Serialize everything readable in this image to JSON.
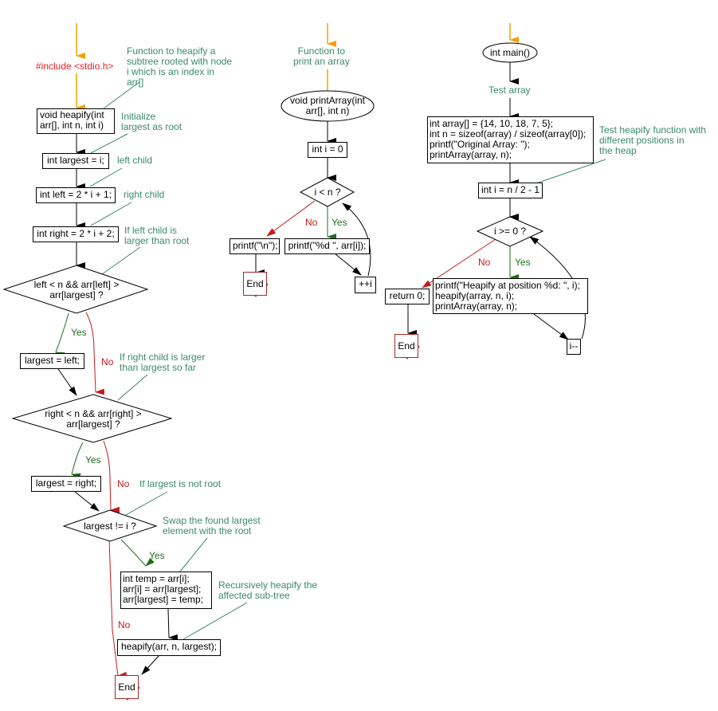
{
  "heapify_flow": {
    "include": "#include <stdio.h>",
    "comment_heapify": "Function to heapify a\nsubtree rooted with node\ni which is an index in\narr[]",
    "signature": "void heapify(int\narr[], int n, int i)",
    "comment_init": "Initialize\nlargest as root",
    "init_largest": "int largest = i;",
    "comment_left": "left child",
    "init_left": "int left = 2 * i + 1;",
    "comment_right": "right child",
    "init_right": "int right = 2 * i + 2;",
    "comment_left_larger": "If left child is\nlarger than root",
    "cond_left": "left < n && arr[left] >\narr[largest] ?",
    "yes1": "Yes",
    "no1": "No",
    "assign_left": "largest = left;",
    "comment_right_larger": "If right child is larger\nthan largest so far",
    "cond_right": "right < n && arr[right] >\narr[largest] ?",
    "yes2": "Yes",
    "no2": "No",
    "assign_right": "largest = right;",
    "comment_not_root": "If largest is not root",
    "cond_not_root": "largest != i ?",
    "comment_swap": "Swap the found largest\nelement with the root",
    "yes3": "Yes",
    "no3": "No",
    "swap": "int temp = arr[i];\narr[i] = arr[largest];\narr[largest] = temp;",
    "comment_recursive": "Recursively heapify the\naffected sub-tree",
    "recurse": "heapify(arr, n, largest);",
    "end": "End"
  },
  "print_flow": {
    "comment": "Function to\nprint an array",
    "signature": "void printArray(int\narr[], int n)",
    "init_i": "int i = 0",
    "cond": "i < n ?",
    "no": "No",
    "yes": "Yes",
    "newline": "printf(\"\\n\");",
    "print_elem": "printf(\"%d \", arr[i]);",
    "increment": "++i",
    "end": "End"
  },
  "main_flow": {
    "signature": "int main()",
    "comment_test_array": "Test array",
    "setup": "int array[] = {14, 10, 18, 7, 5};\nint n = sizeof(array) / sizeof(array[0]);\nprintf(\"Original Array: \");\nprintArray(array, n);",
    "comment_test_heapify": "Test heapify function with\ndifferent positions in\nthe heap",
    "init_i": "int i = n / 2 - 1",
    "cond": "i >= 0 ?",
    "no": "No",
    "yes": "Yes",
    "return": "return 0;",
    "body": "printf(\"Heapify at position %d: \", i);\nheapify(array, n, i);\nprintArray(array, n);",
    "decrement": "i--",
    "end": "End"
  },
  "colors": {
    "entry_arrow": "#f5a000",
    "include_text": "#e8201c",
    "comment_text": "#3a8a6a",
    "yes_branch": "#1f6e1f",
    "no_branch": "#c41a1a",
    "end_border": "#a52a2a"
  }
}
